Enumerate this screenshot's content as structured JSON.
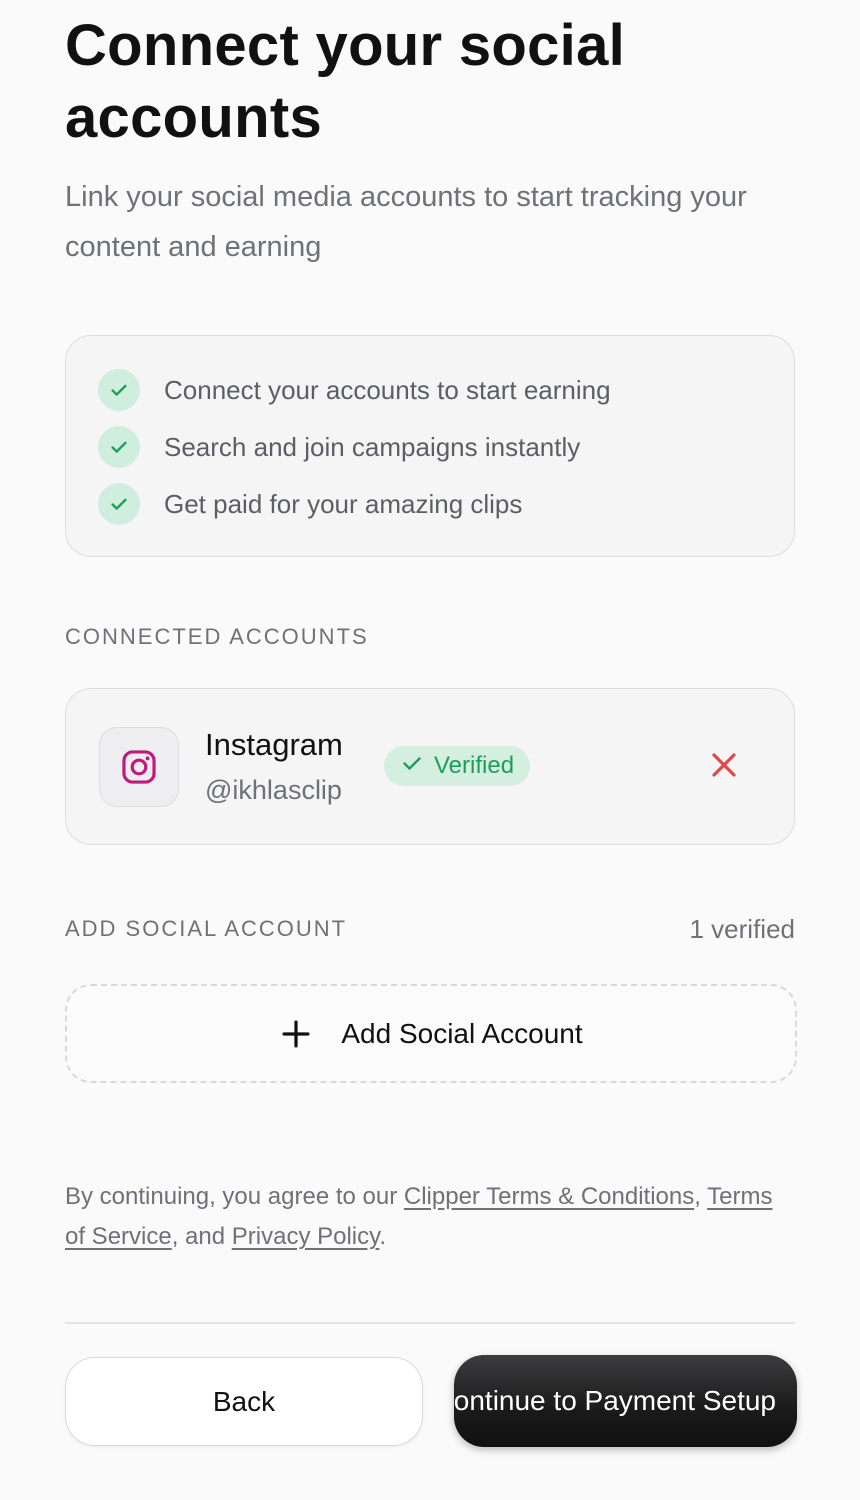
{
  "header": {
    "title": "Connect your social accounts",
    "subtitle": "Link your social media accounts to start tracking your content and earning"
  },
  "benefits": [
    {
      "text": "Connect your accounts to start earning",
      "icon": "check-icon"
    },
    {
      "text": "Search and join campaigns instantly",
      "icon": "check-icon"
    },
    {
      "text": "Get paid for your amazing clips",
      "icon": "check-icon"
    }
  ],
  "connected": {
    "label": "CONNECTED ACCOUNTS",
    "accounts": [
      {
        "platform": "Instagram",
        "handle": "@ikhlasclip",
        "status": "Verified",
        "icon": "instagram-icon",
        "remove_icon": "close-icon"
      }
    ]
  },
  "add_account": {
    "label": "ADD SOCIAL ACCOUNT",
    "verified_count": "1 verified",
    "button_label": "Add Social Account",
    "button_icon": "plus-icon"
  },
  "legal": {
    "prefix": "By continuing, you agree to our ",
    "link1": "Clipper Terms & Conditions",
    "sep1": ", ",
    "link2": "Terms of Service",
    "sep2": ", and ",
    "link3": "Privacy Policy",
    "suffix": "."
  },
  "footer": {
    "back_label": "Back",
    "continue_label": "Continue to Payment Setup"
  },
  "colors": {
    "accent_green": "#1f9d5a",
    "check_bg": "#cfeedd",
    "instagram": "#c2187a",
    "remove_red": "#e0484a",
    "primary_button": "#1a1a1b"
  }
}
